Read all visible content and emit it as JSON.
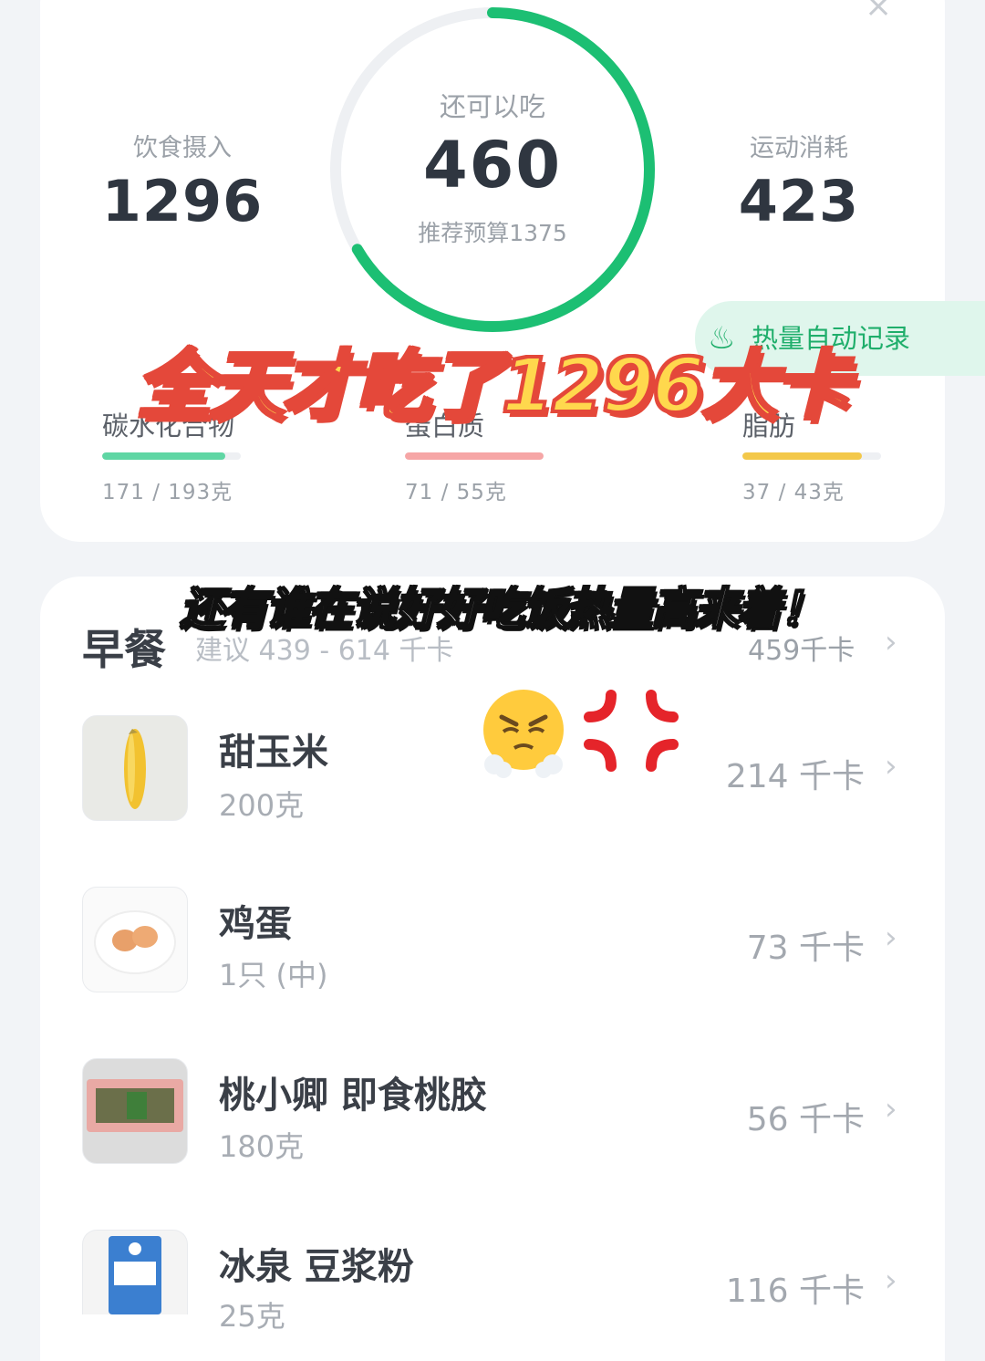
{
  "summary": {
    "close_symbol": "×",
    "intake_label": "饮食摄入",
    "intake_value": "1296",
    "remaining_label": "还可以吃",
    "remaining_value": "460",
    "budget_text": "推荐预算1375",
    "exercise_label": "运动消耗",
    "exercise_value": "423",
    "ring_progress": 0.665,
    "ring_color": "#1cbf73",
    "auto_record_label": "热量自动记录",
    "macros": [
      {
        "name": "碳水化合物",
        "amount": "171 / 193克",
        "progress": 0.89,
        "color": "#5fd6a4"
      },
      {
        "name": "蛋白质",
        "amount": "71 / 55克",
        "progress": 1.0,
        "color": "#f6a6a6"
      },
      {
        "name": "脂肪",
        "amount": "37 / 43克",
        "progress": 0.86,
        "color": "#f3c84a"
      }
    ]
  },
  "overlay": {
    "headline": "全天才吃了1296大卡",
    "subline": "还有谁在说好好吃饭热量高来着！"
  },
  "meal": {
    "title": "早餐",
    "suggestion": "建议 439 - 614 千卡",
    "total": "459千卡",
    "chevron": "›",
    "foods": [
      {
        "name": "甜玉米",
        "amount": "200克",
        "kcal": "214 千卡",
        "icon": "corn-image"
      },
      {
        "name": "鸡蛋",
        "amount": "1只 (中)",
        "kcal": "73 千卡",
        "icon": "eggs-image"
      },
      {
        "name": "桃小卿 即食桃胶",
        "amount": "180克",
        "kcal": "56 千卡",
        "icon": "peach-gum-package-image"
      },
      {
        "name": "冰泉 豆浆粉",
        "amount": "25克",
        "kcal": "116 千卡",
        "icon": "soy-milk-powder-package-image"
      }
    ]
  },
  "emojis": [
    "huffing-face-icon",
    "anger-symbol-icon"
  ]
}
